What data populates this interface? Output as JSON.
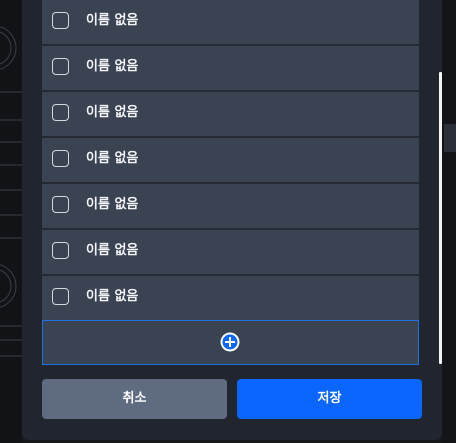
{
  "list": {
    "items": [
      {
        "label": "이름 없음",
        "checked": false
      },
      {
        "label": "이름 없음",
        "checked": false
      },
      {
        "label": "이름 없음",
        "checked": false
      },
      {
        "label": "이름 없음",
        "checked": false
      },
      {
        "label": "이름 없음",
        "checked": false
      },
      {
        "label": "이름 없음",
        "checked": false
      },
      {
        "label": "이름 없음",
        "checked": false
      }
    ],
    "add_icon": "plus-circle-icon"
  },
  "footer": {
    "cancel_label": "취소",
    "save_label": "저장"
  },
  "colors": {
    "accent": "#0a66ff",
    "row_bg": "#3a4352",
    "modal_bg": "#20252e",
    "cancel_bg": "#5f6b80"
  }
}
